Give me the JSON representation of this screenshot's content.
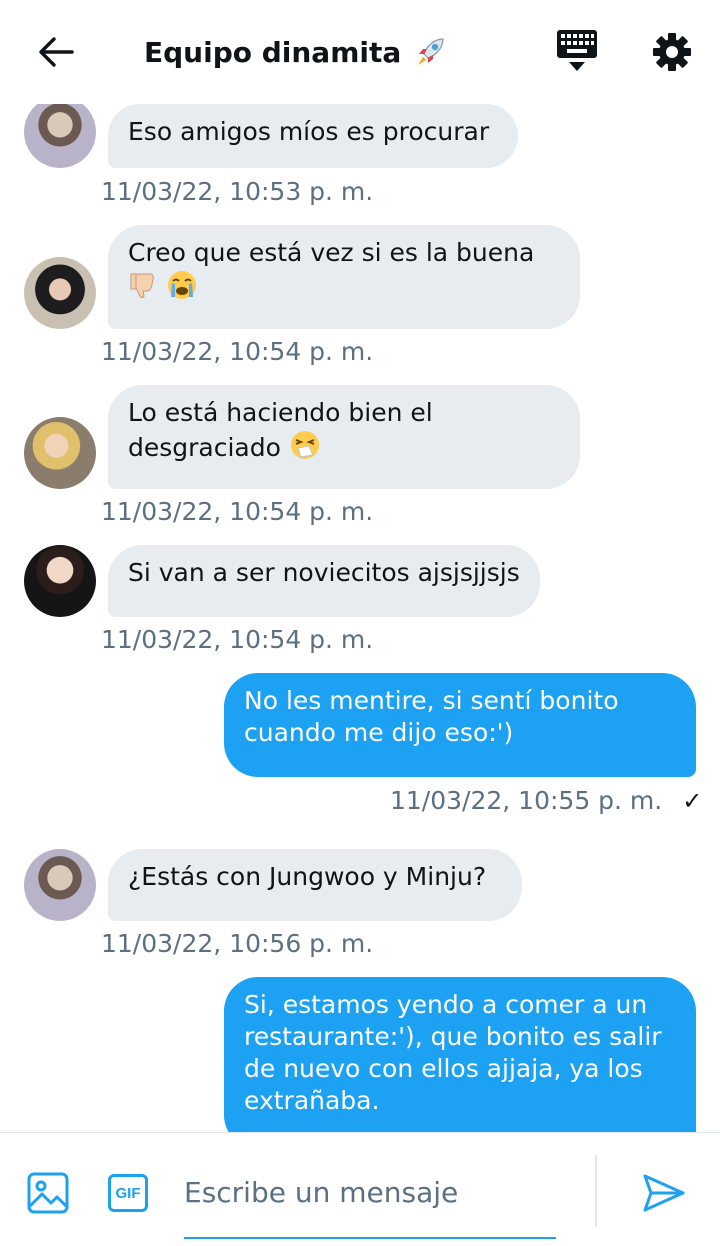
{
  "header": {
    "back_icon": "arrow-left-icon",
    "title": "Equipo dinamita",
    "title_emoji": "rocket-emoji",
    "keyboard_icon": "keyboard-icon",
    "settings_icon": "gear-icon"
  },
  "colors": {
    "accent": "#1da1f2",
    "incoming_bubble": "#e6ecf0",
    "timestamp": "#5b7083",
    "text": "#0f1419"
  },
  "messages": [
    {
      "direction": "in",
      "text": "Eso amigos míos es procurar",
      "time": "11/03/22, 10:53 p. m."
    },
    {
      "direction": "in",
      "text": "Creo que está vez si es la buena",
      "emojis": [
        "thumbs-down-emoji",
        "crying-face-emoji"
      ],
      "time": "11/03/22, 10:54 p. m."
    },
    {
      "direction": "in",
      "text": "Lo está haciendo bien el desgraciado",
      "emojis": [
        "sneezing-face-emoji"
      ],
      "time": "11/03/22, 10:54 p. m."
    },
    {
      "direction": "in",
      "text": "Si van a ser noviecitos ajsjsjjsjs",
      "time": "11/03/22, 10:54 p. m."
    },
    {
      "direction": "out",
      "text": "No les mentire, si sentí bonito cuando me dijo eso:')",
      "time": "11/03/22, 10:55 p. m.",
      "status_icon": "check-icon"
    },
    {
      "direction": "in",
      "text": "¿Estás con Jungwoo y Minju?",
      "time": "11/03/22, 10:56 p. m."
    },
    {
      "direction": "out",
      "text": "Si, estamos yendo a comer a un restaurante:'), que bonito es salir de nuevo con ellos ajjaja, ya los extrañaba."
    }
  ],
  "composer": {
    "image_icon": "image-icon",
    "gif_label": "GIF",
    "placeholder": "Escribe un mensaje",
    "value": "",
    "send_icon": "send-icon"
  }
}
